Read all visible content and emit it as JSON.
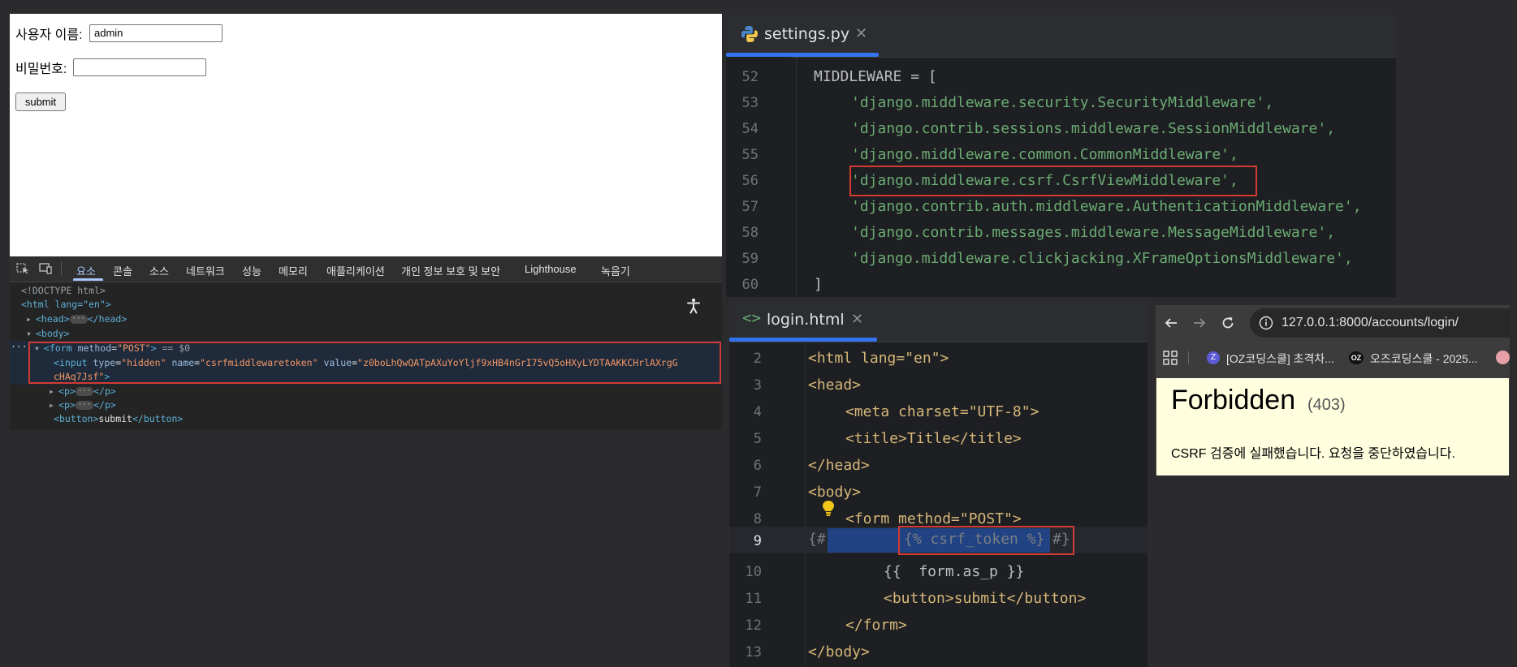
{
  "login_form": {
    "username_label": "사용자 이름:",
    "username_value": "admin",
    "password_label": "비밀번호:",
    "password_value": "",
    "submit_label": "submit"
  },
  "devtools": {
    "tabs": [
      "요소",
      "콘솔",
      "소스",
      "네트워크",
      "성능",
      "메모리",
      "애플리케이션",
      "개인 정보 보호 및 보안",
      "Lighthouse",
      "녹음기"
    ],
    "active_tab": "요소",
    "dom": {
      "doctype": "<!DOCTYPE html>",
      "html_open": "<html lang=\"en\">",
      "head_line": "<head>",
      "head_close": "</head>",
      "body_open": "<body>",
      "form_tag": "form",
      "form_attr_name": "method",
      "form_attr_value": "\"POST\"",
      "form_suffix": "== $0",
      "input_tag": "input",
      "input_type_value": "\"hidden\"",
      "input_name_value": "\"csrfmiddlewaretoken\"",
      "input_value_1": "\"z0boLhQwQATpAXuYoYljf9xHB4nGrI75vQ5oHXyLYDTAAKKCHrlAXrgG",
      "input_value_2": "cHAq7Jsf\"",
      "p_tag": "p",
      "button_tag": "button",
      "button_text": "submit"
    }
  },
  "settings_editor": {
    "filename": "settings.py",
    "lines": [
      {
        "num": "52",
        "text": "MIDDLEWARE = ["
      },
      {
        "num": "53",
        "text": "'django.middleware.security.SecurityMiddleware',"
      },
      {
        "num": "54",
        "text": "'django.contrib.sessions.middleware.SessionMiddleware',"
      },
      {
        "num": "55",
        "text": "'django.middleware.common.CommonMiddleware',"
      },
      {
        "num": "56",
        "text": "'django.middleware.csrf.CsrfViewMiddleware',"
      },
      {
        "num": "57",
        "text": "'django.contrib.auth.middleware.AuthenticationMiddleware',"
      },
      {
        "num": "58",
        "text": "'django.contrib.messages.middleware.MessageMiddleware',"
      },
      {
        "num": "59",
        "text": "'django.middleware.clickjacking.XFrameOptionsMiddleware',"
      },
      {
        "num": "60",
        "text": "]"
      }
    ]
  },
  "login_editor": {
    "filename": "login.html",
    "lines": [
      {
        "num": "2",
        "text": "<html lang=\"en\">"
      },
      {
        "num": "3",
        "text": "<head>"
      },
      {
        "num": "4",
        "text": "<meta charset=\"UTF-8\">"
      },
      {
        "num": "5",
        "text": "<title>Title</title>"
      },
      {
        "num": "6",
        "text": "</head>"
      },
      {
        "num": "7",
        "text": "<body>"
      },
      {
        "num": "8",
        "text": "<form method=\"POST\">"
      },
      {
        "num": "9",
        "text": "{#"
      },
      {
        "num": "10",
        "text": "{{  form.as_p }}"
      },
      {
        "num": "11",
        "text": "<button>submit</button>"
      },
      {
        "num": "12",
        "text": "</form>"
      },
      {
        "num": "13",
        "text": "</body>"
      }
    ],
    "line9_token": "{% csrf_token %}",
    "line9_end": "#}"
  },
  "browser": {
    "url": "127.0.0.1:8000/accounts/login/",
    "bookmarks": [
      "[OZ코딩스쿨] 초격차...",
      "오즈코딩스쿨 - 2025..."
    ],
    "bookmark_badge": "OZ",
    "page_title": "Forbidden",
    "status_code": "(403)",
    "message": "CSRF 검증에 실패했습니다. 요청을 중단하였습니다."
  }
}
